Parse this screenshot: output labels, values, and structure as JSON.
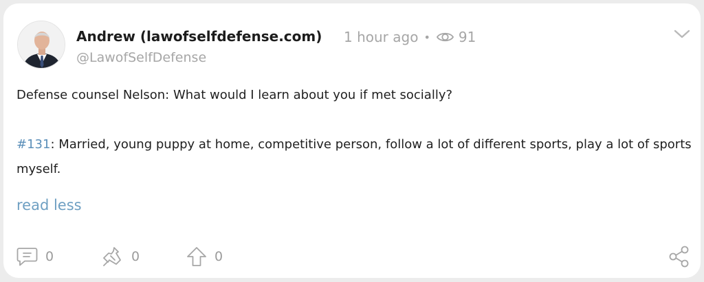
{
  "post": {
    "author": {
      "display_name": "Andrew (lawofselfdefense.com)",
      "handle": "@LawofSelfDefense"
    },
    "time_ago": "1 hour ago",
    "separator": "•",
    "views": "91",
    "body": {
      "line1": "Defense counsel Nelson: What would I learn about you if met socially?",
      "hashtag": "#131",
      "line2": ": Married, young puppy at home, competitive person, follow a lot of different sports, play a lot of sports myself."
    },
    "read_less": "read less",
    "actions": {
      "comments": "0",
      "reposts": "0",
      "upvotes": "0"
    }
  },
  "icons": {
    "views": "eye-icon",
    "expand": "chevron-down-icon",
    "comments": "comment-icon",
    "reposts": "repost-icon",
    "upvotes": "arrow-up-icon",
    "share": "share-icon"
  },
  "colors": {
    "link": "#6e9fc2",
    "muted": "#a6a6a6",
    "card": "#ffffff",
    "background": "#ececec"
  }
}
